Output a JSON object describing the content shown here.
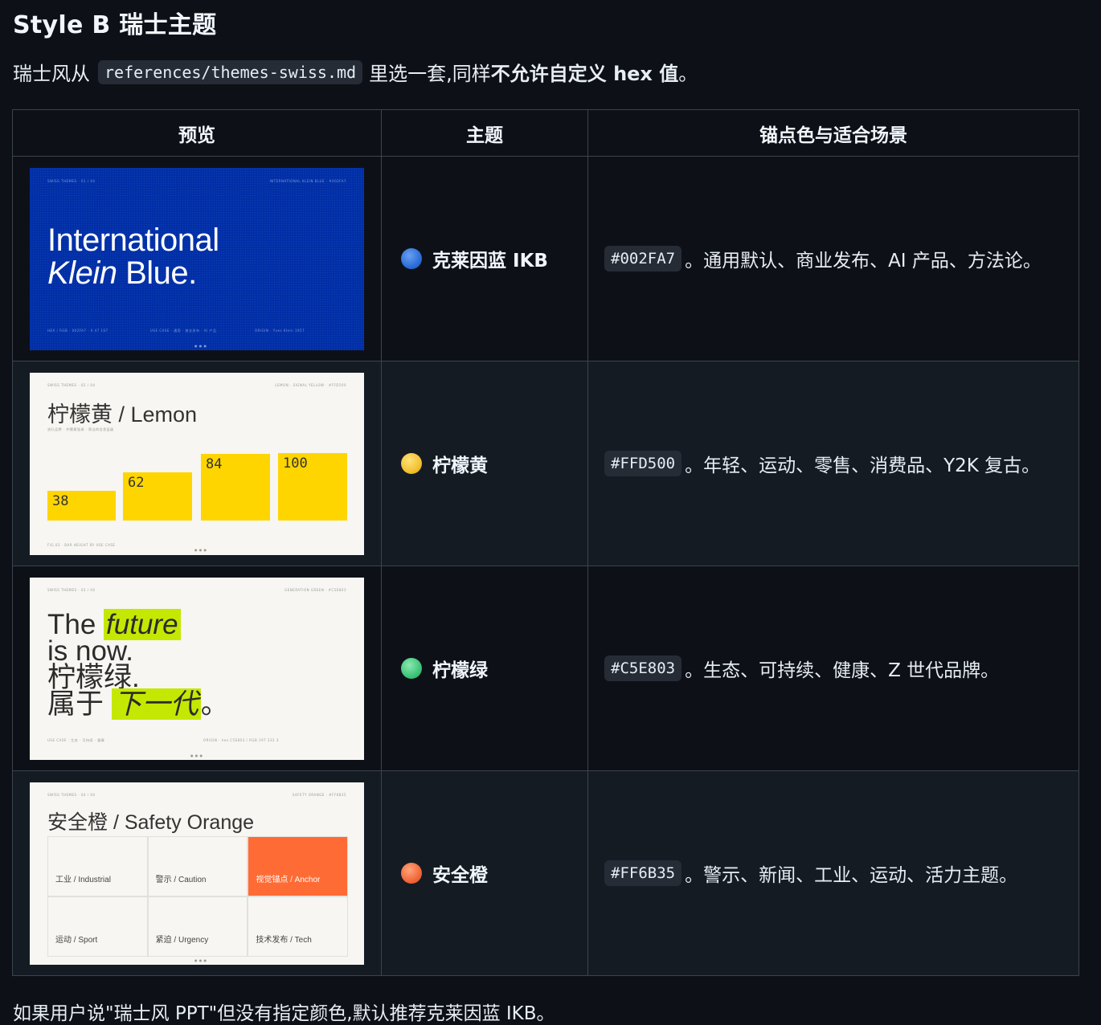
{
  "heading": "Style B 瑞士主题",
  "intro": {
    "before": "瑞士风从",
    "code": "references/themes-swiss.md",
    "middle": "里选一套,同样",
    "bold": "不允许自定义 hex 值",
    "end": "。"
  },
  "table": {
    "headers": [
      "预览",
      "主题",
      "锚点色与适合场景"
    ],
    "rows": [
      {
        "name": "克莱因蓝 IKB",
        "hex": "#002FA7",
        "desc": "。通用默认、商业发布、AI 产品、方法论。",
        "dot_color": "#2d6fd8",
        "preview": {
          "line1": "International",
          "line2a": "Klein",
          "line2b": " Blue."
        }
      },
      {
        "name": "柠檬黄",
        "hex": "#FFD500",
        "desc": "。年轻、运动、零售、消费品、Y2K 复古。",
        "dot_color": "#f2c232",
        "preview": {
          "title": "柠檬黄 / Lemon",
          "bars": [
            {
              "label": "38",
              "value": 38
            },
            {
              "label": "62",
              "value": 62
            },
            {
              "label": "84",
              "value": 84
            },
            {
              "label": "100",
              "value": 100
            }
          ]
        }
      },
      {
        "name": "柠檬绿",
        "hex": "#C5E803",
        "desc": "。生态、可持续、健康、Z 世代品牌。",
        "dot_color": "#3fc57a",
        "preview": {
          "w1": "The ",
          "w2": "future",
          "w3": "is now.",
          "w4": "柠檬绿.",
          "w5": "属于 ",
          "w6": "下一代",
          "w7": "。"
        }
      },
      {
        "name": "安全橙",
        "hex": "#FF6B35",
        "desc": "。警示、新闻、工业、运动、活力主题。",
        "dot_color": "#f2683a",
        "preview": {
          "title": "安全橙 / Safety Orange",
          "cells": [
            "工业 / Industrial",
            "警示 / Caution",
            "视觉锚点 / Anchor",
            "运动 / Sport",
            "紧迫 / Urgency",
            "技术发布 / Tech"
          ]
        }
      }
    ]
  },
  "footer_text": "如果用户说\"瑞士风 PPT\"但没有指定颜色,默认推荐克莱因蓝 IKB。"
}
